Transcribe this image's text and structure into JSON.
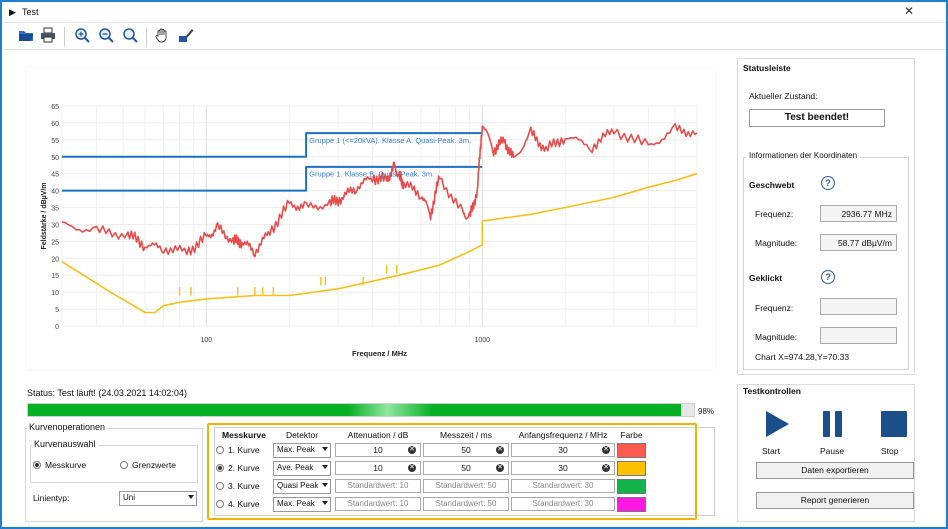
{
  "window": {
    "title": "Test"
  },
  "toolbar": {
    "tools": [
      "open-icon",
      "print-icon",
      "zoom-in-icon",
      "zoom-out-icon",
      "zoom-reset-icon",
      "pan-hand-icon",
      "draw-icon"
    ]
  },
  "chart_data": {
    "type": "line",
    "xlabel": "Frequenz / MHz",
    "ylabel": "Feldstärke / dBµV/m",
    "x_scale": "log",
    "xlim": [
      30,
      6000
    ],
    "ylim": [
      0,
      65
    ],
    "x_ticks": [
      "100",
      "1000"
    ],
    "y_ticks": [
      "0",
      "5",
      "10",
      "15",
      "20",
      "25",
      "30",
      "35",
      "40",
      "45",
      "50",
      "55",
      "60",
      "65"
    ],
    "grid": true,
    "annotations": [
      "Gruppe 1 (<=20kVA). Klasse A. Quasi-Peak. 3m.",
      "Gruppe 1. Klasse B. Quasi-Peak. 3m."
    ],
    "series": [
      {
        "color": "#1f6fc4",
        "x": [
          30,
          230,
          230,
          1000
        ],
        "y": [
          50,
          50,
          57,
          57
        ]
      },
      {
        "color": "#1f6fc4",
        "x": [
          30,
          230,
          230,
          1000
        ],
        "y": [
          40,
          40,
          47,
          47
        ]
      },
      {
        "color": "#e84c4c",
        "x": [
          30,
          40,
          52,
          60,
          70,
          85,
          100,
          110,
          125,
          135,
          150,
          170,
          200,
          230,
          280,
          310,
          350,
          400,
          450,
          480,
          500,
          520,
          600,
          650,
          700,
          850,
          900,
          960,
          1000,
          1100,
          1200,
          1300,
          1500,
          1700,
          2000,
          2500,
          3000,
          4000,
          5000,
          6000
        ],
        "y": [
          30,
          28,
          27,
          24,
          23,
          22,
          26,
          29,
          25,
          25,
          22,
          28,
          36,
          35,
          36,
          38,
          41,
          44,
          43,
          47,
          44,
          42,
          39,
          33,
          44,
          33,
          32,
          40,
          60,
          52,
          55,
          49,
          57,
          52,
          56,
          53,
          58,
          53,
          58,
          57
        ]
      },
      {
        "color": "#f2c11b",
        "x": [
          30,
          45,
          60,
          65,
          70,
          80,
          100,
          150,
          200,
          300,
          500,
          700,
          900,
          1000,
          1000,
          1500,
          2000,
          3000,
          4000,
          5000,
          6000
        ],
        "y": [
          19,
          10,
          4,
          4,
          6,
          7,
          8,
          9,
          9,
          11,
          15,
          18,
          22,
          24,
          31,
          33,
          35,
          38,
          41,
          43,
          45
        ]
      }
    ]
  },
  "status": {
    "text": "Status: Test läuft! (24.03.2021 14:02:04)",
    "progress": 98,
    "progress_label": "98%"
  },
  "kurvenoperationen": {
    "title": "Kurvenoperationen",
    "auswahl_title": "Kurvenauswahl",
    "option1": "Messkurve",
    "option2": "Grenzwerte",
    "linientyp_label": "Linientyp:",
    "linientyp_value": "Uni"
  },
  "table": {
    "headers": [
      "Messkurve",
      "Detektor",
      "Attenuation / dB",
      "Messzeit / ms",
      "Anfangsfrequenz / MHz",
      "Farbe"
    ],
    "rows": [
      {
        "label": "1. Kurve",
        "detector": "Max. Peak",
        "attenuation": "10",
        "messzeit": "50",
        "anfangsfrequenz": "30",
        "color": "#ff5a4e",
        "selected": false,
        "enabled": true
      },
      {
        "label": "2. Kurve",
        "detector": "Ave. Peak",
        "attenuation": "10",
        "messzeit": "50",
        "anfangsfrequenz": "30",
        "color": "#ffc000",
        "selected": true,
        "enabled": true
      },
      {
        "label": "3. Kurve",
        "detector": "Quasi Peak",
        "attenuation": "Standardwert: 10",
        "messzeit": "Standardwert: 50",
        "anfangsfrequenz": "Standardwert: 30",
        "color": "#13b24a",
        "selected": false,
        "enabled": false
      },
      {
        "label": "4. Kurve",
        "detector": "Max. Peak",
        "attenuation": "Standardwert: 10",
        "messzeit": "Standardwert: 50",
        "anfangsfrequenz": "Standardwert: 30",
        "color": "#ff19e2",
        "selected": false,
        "enabled": false
      }
    ]
  },
  "statusleiste": {
    "title": "Statusleiste",
    "zustand_label": "Aktueller Zustand:",
    "zustand_button": "Test beendet!",
    "koord_title": "Informationen der Koordinaten",
    "geschwebt": "Geschwebt",
    "frequenz_label": "Frequenz:",
    "frequenz_value": "2936.77 MHz",
    "magnitude_label": "Magnitude:",
    "magnitude_value": "58.77 dBµV/m",
    "geklickt": "Geklickt",
    "frequenz2_label": "Frequenz:",
    "magnitude2_label": "Magnitude:",
    "chart_coord": "Chart X=974.28,Y=70.33"
  },
  "testkontrollen": {
    "title": "Testkontrollen",
    "start": "Start",
    "pause": "Pause",
    "stop": "Stop",
    "export": "Daten exportieren",
    "report": "Report generieren"
  }
}
